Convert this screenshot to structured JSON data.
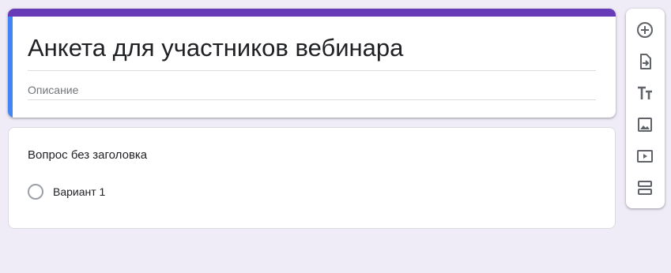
{
  "form": {
    "title": "Анкета для участников вебинара",
    "description_placeholder": "Описание"
  },
  "question": {
    "title": "Вопрос без заголовка",
    "options": [
      "Вариант 1"
    ]
  },
  "toolbar": {
    "tools": [
      "add-question-icon",
      "import-questions-icon",
      "add-title-icon",
      "add-image-icon",
      "add-video-icon",
      "add-section-icon"
    ]
  },
  "colors": {
    "accent": "#673ab7",
    "focus": "#4285f4",
    "background": "#efebf7"
  }
}
